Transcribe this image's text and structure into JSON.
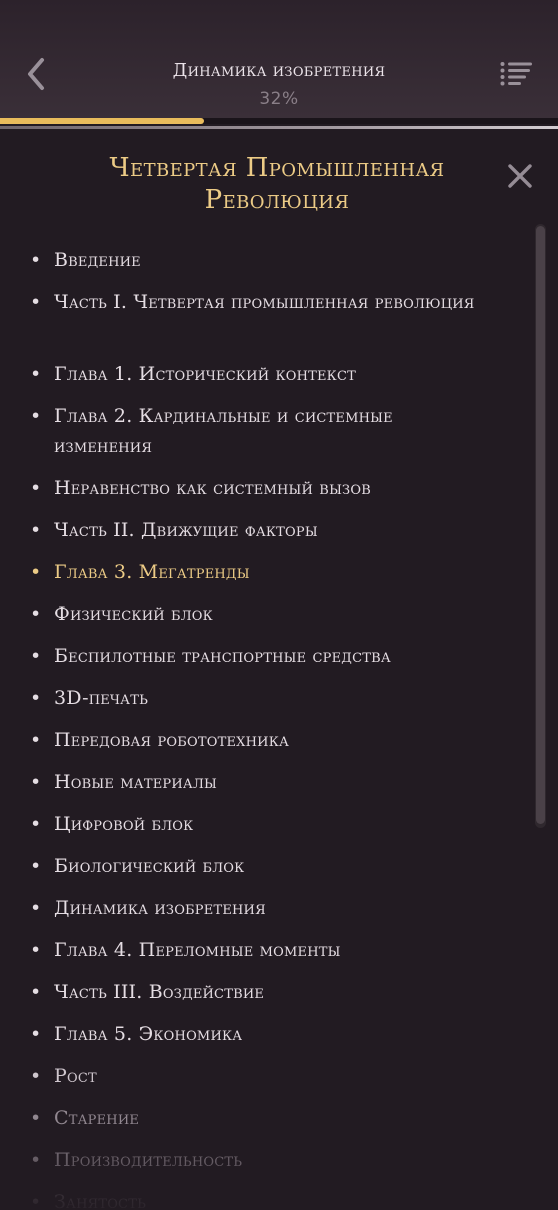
{
  "header": {
    "title": "Динамика изобретения",
    "percent_label": "32%",
    "progress_fraction": 0.365,
    "back_icon": "chevron-left-icon",
    "menu_icon": "list-icon"
  },
  "toc": {
    "title": "Четвертая Промышленная Революция",
    "close_icon": "close-icon",
    "items": [
      {
        "label": "Введение"
      },
      {
        "label": "Часть I. Четвертая промышленная революция"
      },
      {
        "label": "Глава 1. Исторический контекст"
      },
      {
        "label": "Глава 2. Кардинальные и системные изменения"
      },
      {
        "label": "Неравенство как системный вызов"
      },
      {
        "label": "Часть II. Движущие факторы"
      },
      {
        "label": "Глава 3. Мегатренды"
      },
      {
        "label": "Физический блок"
      },
      {
        "label": "Беспилотные транспортные средства"
      },
      {
        "label": "3D-печать"
      },
      {
        "label": "Передовая робототехника"
      },
      {
        "label": "Новые материалы"
      },
      {
        "label": "Цифровой блок"
      },
      {
        "label": "Биологический блок"
      },
      {
        "label": "Динамика изобретения"
      },
      {
        "label": "Глава 4. Переломные моменты"
      },
      {
        "label": "Часть III. Воздействие"
      },
      {
        "label": "Глава 5. Экономика"
      },
      {
        "label": "Рост"
      },
      {
        "label": "Старение"
      },
      {
        "label": "Производительность"
      },
      {
        "label": "Занятость"
      }
    ],
    "active_index": 6
  },
  "colors": {
    "accent": "#e9bc5c",
    "title_gold": "#eccb86",
    "text": "#e5dde3",
    "background": "#221b22"
  }
}
